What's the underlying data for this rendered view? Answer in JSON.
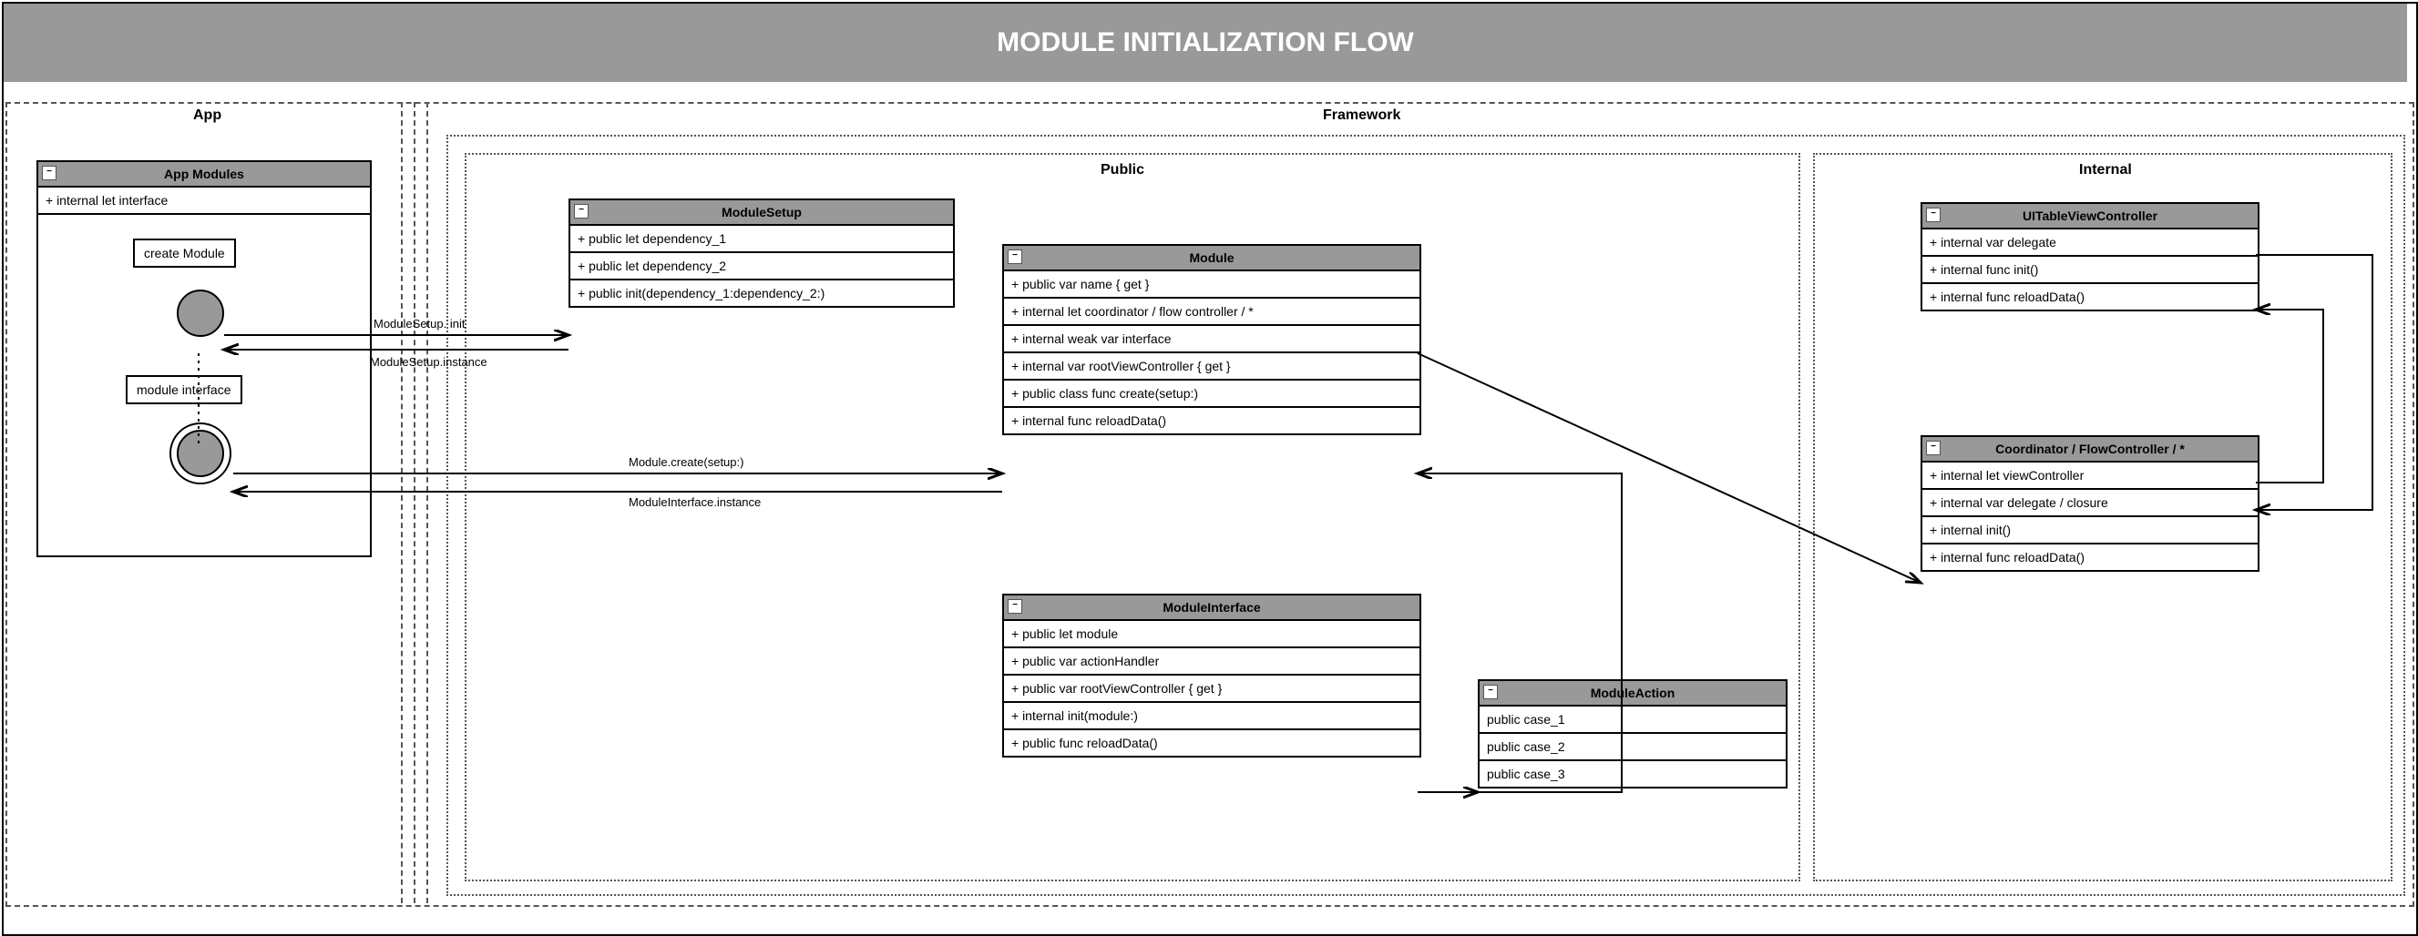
{
  "title": "MODULE INITIALIZATION FLOW",
  "sections": {
    "app": "App",
    "framework": "Framework",
    "public": "Public",
    "internal": "Internal"
  },
  "appModules": {
    "title": "App Modules",
    "row0": "+ internal let interface",
    "labelCreate": "create Module",
    "labelInterface": "module interface"
  },
  "moduleSetup": {
    "title": "ModuleSetup",
    "r0": "+ public let dependency_1",
    "r1": "+ public let dependency_2",
    "r2": "+ public init(dependency_1:dependency_2:)"
  },
  "module": {
    "title": "Module",
    "r0": "+ public var name { get }",
    "r1": "+ internal let coordinator / flow controller / *",
    "r2": "+ internal weak var interface",
    "r3": "+ internal var rootViewController { get }",
    "r4": "+ public class func create(setup:)",
    "r5": "+ internal func reloadData()"
  },
  "moduleInterface": {
    "title": "ModuleInterface",
    "r0": "+ public let module",
    "r1": "+ public var actionHandler",
    "r2": "+ public var rootViewController { get }",
    "r3": "+ internal init(module:)",
    "r4": "+ public func reloadData()"
  },
  "moduleAction": {
    "title": "ModuleAction",
    "r0": "public case_1",
    "r1": "public case_2",
    "r2": "public case_3"
  },
  "uitvc": {
    "title": "UITableViewController",
    "r0": "+ internal var delegate",
    "r1": "+ internal func init()",
    "r2": "+ internal func reloadData()"
  },
  "coordinator": {
    "title": "Coordinator / FlowController / *",
    "r0": "+ internal let viewController",
    "r1": "+ internal var delegate / closure",
    "r2": "+ internal init()",
    "r3": "+ internal func reloadData()"
  },
  "edges": {
    "e1t": "ModuleSetup. init",
    "e1b": "ModuleSetup.instance",
    "e2t": "Module.create(setup:)",
    "e2b": "ModuleInterface.instance"
  },
  "glyphs": {
    "minus": "−"
  }
}
